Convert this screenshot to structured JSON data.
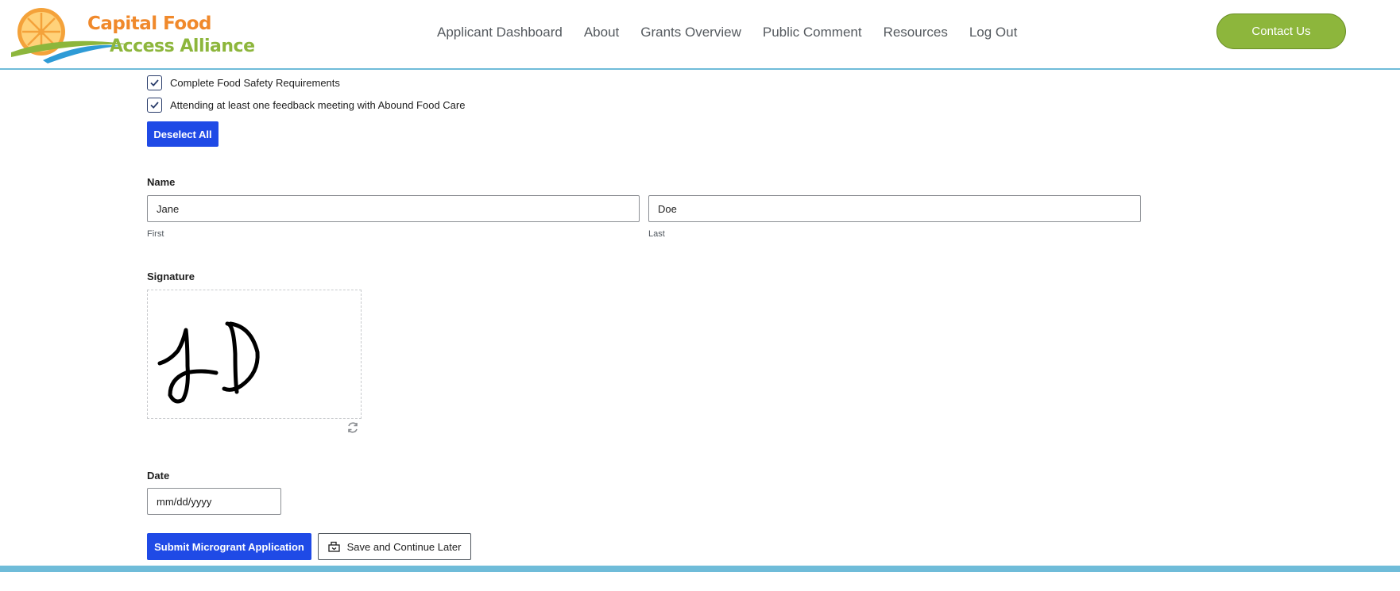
{
  "header": {
    "logo": {
      "line1": "Capital Food",
      "line2": "Access Alliance"
    },
    "nav": [
      {
        "label": "Applicant Dashboard"
      },
      {
        "label": "About"
      },
      {
        "label": "Grants Overview"
      },
      {
        "label": "Public Comment"
      },
      {
        "label": "Resources"
      },
      {
        "label": "Log Out"
      }
    ],
    "contact_label": "Contact Us"
  },
  "form": {
    "checkboxes": [
      {
        "label": "Complete Food Safety Requirements",
        "checked": true
      },
      {
        "label": "Attending at least one feedback meeting with Abound Food Care",
        "checked": true
      }
    ],
    "deselect_label": "Deselect All",
    "name": {
      "label": "Name",
      "first_value": "Jane",
      "first_sublabel": "First",
      "last_value": "Doe",
      "last_sublabel": "Last"
    },
    "signature": {
      "label": "Signature"
    },
    "date": {
      "label": "Date",
      "placeholder": "mm/dd/yyyy"
    },
    "submit_label": "Submit Microgrant Application",
    "save_label": "Save and Continue Later"
  },
  "colors": {
    "primary_button": "#1f4ae6",
    "accent_green": "#8db63c",
    "accent_orange": "#f0892b",
    "header_rule": "#6fbcd9"
  }
}
